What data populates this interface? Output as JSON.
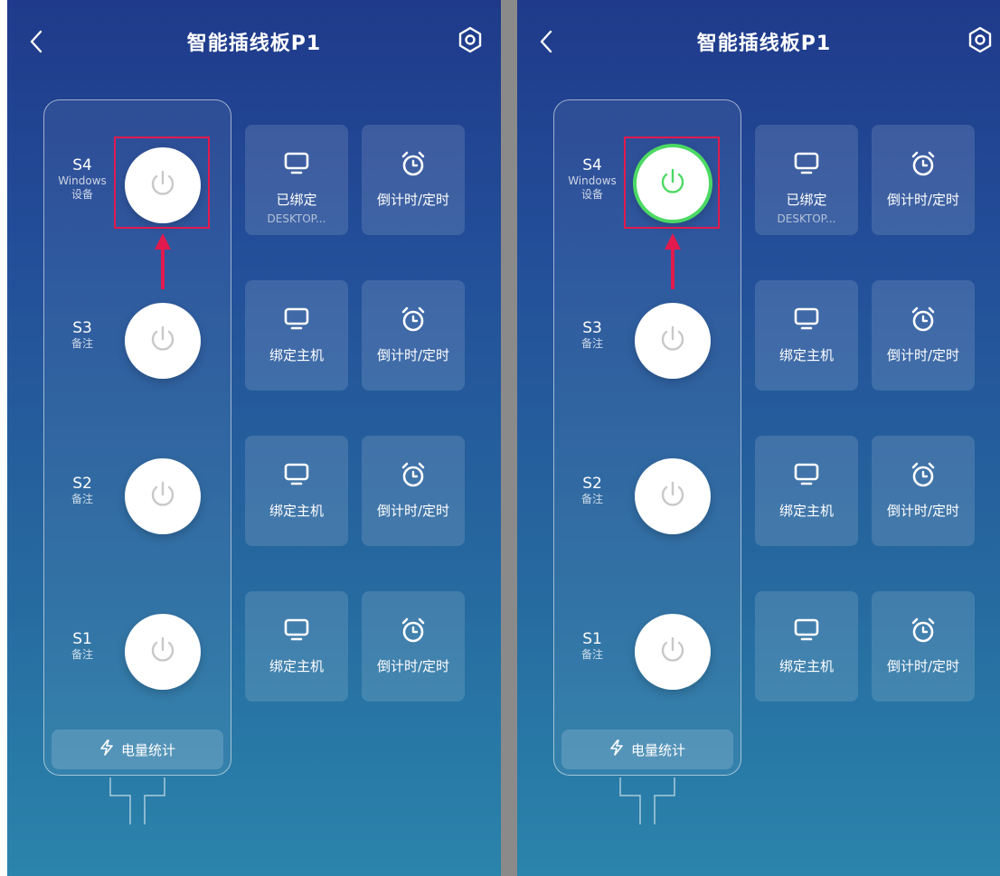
{
  "screens": [
    {
      "header": {
        "title": "智能插线板P1",
        "back_icon": "chevron-left-icon",
        "settings_icon": "hex-settings-icon"
      },
      "outlets": [
        {
          "name": "S4",
          "note1": "Windows",
          "note2": "设备",
          "power_on": false
        },
        {
          "name": "S3",
          "note1": "备注",
          "power_on": false
        },
        {
          "name": "S2",
          "note1": "备注",
          "power_on": false
        },
        {
          "name": "S1",
          "note1": "备注",
          "power_on": false
        }
      ],
      "tiles": [
        {
          "bind_label": "已绑定",
          "bind_sub": "DESKTOP...",
          "timer_label": "倒计时/定时"
        },
        {
          "bind_label": "绑定主机",
          "timer_label": "倒计时/定时"
        },
        {
          "bind_label": "绑定主机",
          "timer_label": "倒计时/定时"
        },
        {
          "bind_label": "绑定主机",
          "timer_label": "倒计时/定时"
        }
      ],
      "energy_label": "电量统计"
    },
    {
      "header": {
        "title": "智能插线板P1",
        "back_icon": "chevron-left-icon",
        "settings_icon": "hex-settings-icon"
      },
      "outlets": [
        {
          "name": "S4",
          "note1": "Windows",
          "note2": "设备",
          "power_on": true
        },
        {
          "name": "S3",
          "note1": "备注",
          "power_on": false
        },
        {
          "name": "S2",
          "note1": "备注",
          "power_on": false
        },
        {
          "name": "S1",
          "note1": "备注",
          "power_on": false
        }
      ],
      "tiles": [
        {
          "bind_label": "已绑定",
          "bind_sub": "DESKTOP...",
          "timer_label": "倒计时/定时"
        },
        {
          "bind_label": "绑定主机",
          "timer_label": "倒计时/定时"
        },
        {
          "bind_label": "绑定主机",
          "timer_label": "倒计时/定时"
        },
        {
          "bind_label": "绑定主机",
          "timer_label": "倒计时/定时"
        }
      ],
      "energy_label": "电量统计"
    }
  ],
  "colors": {
    "power_on": "#4cd964",
    "power_off": "#c8c8c8",
    "highlight": "#e21a4d"
  }
}
